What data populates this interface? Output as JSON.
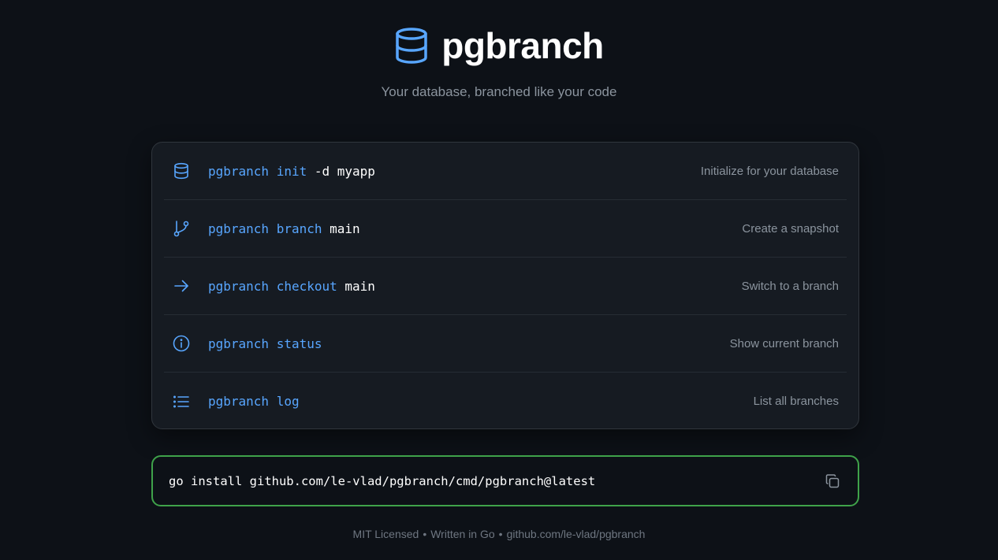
{
  "header": {
    "title": "pgbranch",
    "tagline": "Your database, branched like your code",
    "logo_icon": "database-icon"
  },
  "colors": {
    "background": "#0d1117",
    "card": "#161b22",
    "keyword": "#58a6ff",
    "accent_green": "#3fa24a",
    "muted": "#8b949e"
  },
  "commands": [
    {
      "icon": "database-icon",
      "program": "pgbranch",
      "subcommand": "init",
      "args": "-d myapp",
      "description": "Initialize for your database"
    },
    {
      "icon": "git-branch-icon",
      "program": "pgbranch",
      "subcommand": "branch",
      "args": "main",
      "description": "Create a snapshot"
    },
    {
      "icon": "arrow-right-icon",
      "program": "pgbranch",
      "subcommand": "checkout",
      "args": "main",
      "description": "Switch to a branch"
    },
    {
      "icon": "info-icon",
      "program": "pgbranch",
      "subcommand": "status",
      "args": "",
      "description": "Show current branch"
    },
    {
      "icon": "list-icon",
      "program": "pgbranch",
      "subcommand": "log",
      "args": "",
      "description": "List all branches"
    }
  ],
  "install": {
    "command": "go install github.com/le-vlad/pgbranch/cmd/pgbranch@latest",
    "copy_icon": "copy-icon"
  },
  "footer": {
    "license": "MIT Licensed",
    "separator": "•",
    "language": "Written in Go",
    "repo": "github.com/le-vlad/pgbranch"
  }
}
